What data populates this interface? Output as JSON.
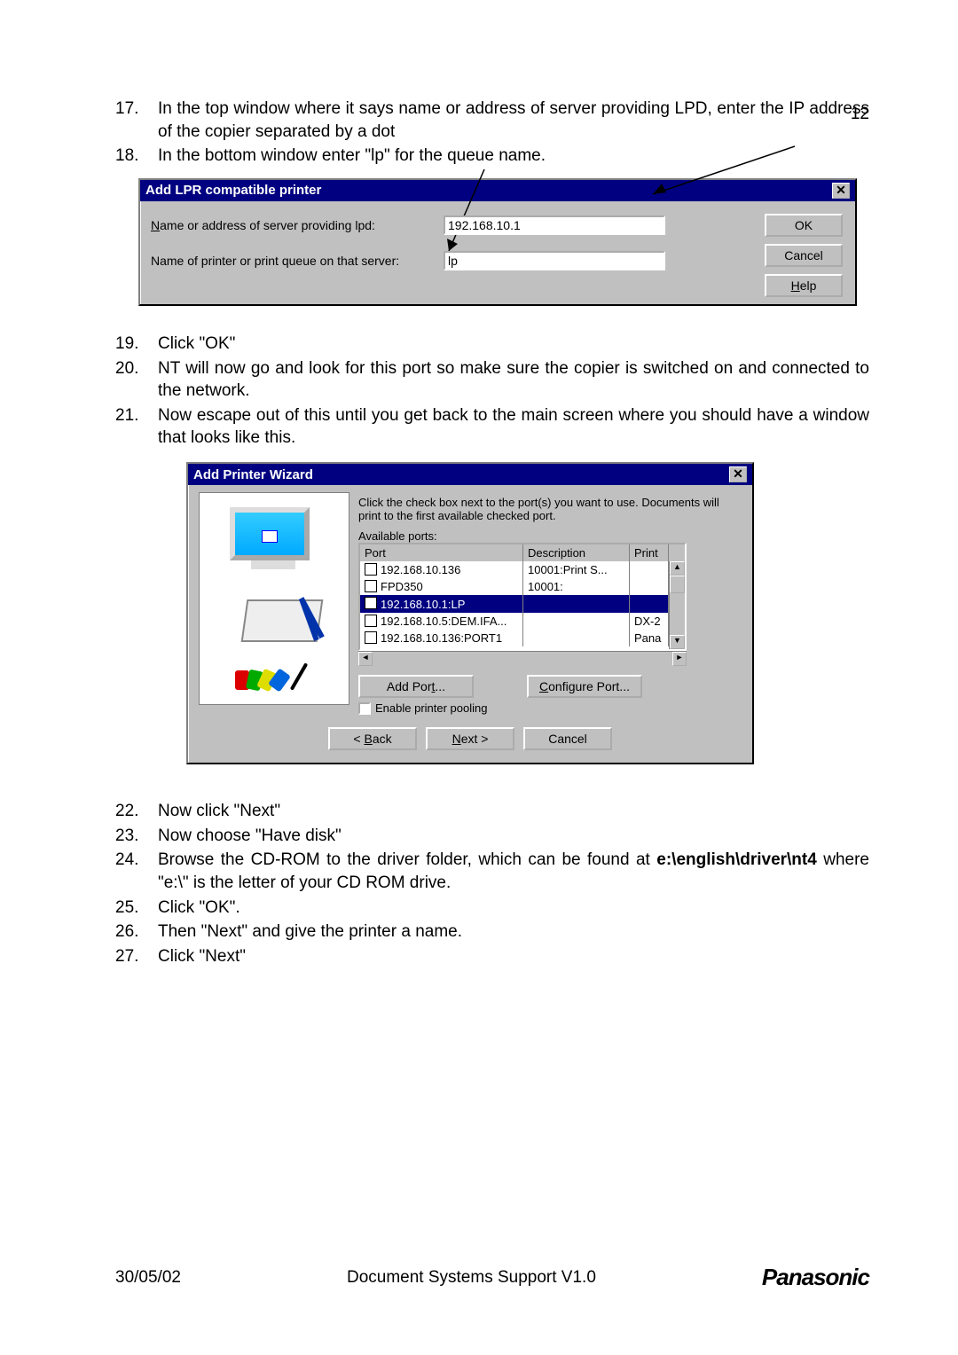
{
  "page_number": "12",
  "steps_a": [
    {
      "n": "17.",
      "t": "In the top window where it says name or address of server providing LPD, enter the IP address of the copier separated by a dot"
    },
    {
      "n": "18.",
      "t": "In the bottom window enter \"lp\" for the queue name."
    }
  ],
  "dlg1": {
    "title": "Add LPR compatible printer",
    "label_server_pre": "N",
    "label_server_post": "ame or address of server providing lpd:",
    "label_queue": "Name of printer or print queue on that server:",
    "val_server": "192.168.10.1",
    "val_queue": "lp",
    "btn_ok": "OK",
    "btn_cancel": "Cancel",
    "btn_help_pre": "H",
    "btn_help_post": "elp"
  },
  "steps_b": [
    {
      "n": "19.",
      "t": "Click \"OK\""
    },
    {
      "n": "20.",
      "t": "NT will now go and look for this port so make sure the copier is switched on and connected to the network."
    },
    {
      "n": "21.",
      "t": "Now escape out of this until you get back to the main screen where you should have a window that looks like this."
    }
  ],
  "dlg2": {
    "title": "Add Printer Wizard",
    "instr": "Click the check box next to the port(s) you want to use. Documents will print to the first available checked port.",
    "avail_pre": "A",
    "avail_post": "vailable ports:",
    "hdr_port": "Port",
    "hdr_desc": "Description",
    "hdr_pr": "Print",
    "rows": [
      {
        "port": "192.168.10.136",
        "desc": "10001:Print S...",
        "pr": "",
        "checked": false,
        "sel": false
      },
      {
        "port": "FPD350",
        "desc": "10001:",
        "pr": "",
        "checked": false,
        "sel": false
      },
      {
        "port": "192.168.10.1:LP",
        "desc": "",
        "pr": "",
        "checked": true,
        "sel": true
      },
      {
        "port": "192.168.10.5:DEM.IFA...",
        "desc": "",
        "pr": "DX-2",
        "checked": false,
        "sel": false
      },
      {
        "port": "192.168.10.136:PORT1",
        "desc": "",
        "pr": "Pana",
        "checked": false,
        "sel": false
      }
    ],
    "add_port_pre": "Add Por",
    "add_port_u": "t",
    "add_port_post": "...",
    "conf_port_pre": "C",
    "conf_port_post": "onfigure Port...",
    "pool_pre": "E",
    "pool_post": "nable printer pooling",
    "back_pre": "< ",
    "back_u": "B",
    "back_post": "ack",
    "next_pre": "N",
    "next_post": "ext >",
    "cancel": "Cancel"
  },
  "steps_c": [
    {
      "n": "22.",
      "t": "Now click \"Next\""
    },
    {
      "n": "23.",
      "t": "Now choose \"Have disk\""
    },
    {
      "n": "24.",
      "t_pre": "Browse the CD-ROM to the driver folder, which can be found at ",
      "t_bold": "e:\\english\\driver\\nt4",
      "t_post": "  where \"e:\\\" is the letter of your CD ROM drive."
    },
    {
      "n": "25.",
      "t": "Click \"OK\"."
    },
    {
      "n": "26.",
      "t": "Then \"Next\" and give the printer a name."
    },
    {
      "n": "27.",
      "t": "Click \"Next\""
    }
  ],
  "footer": {
    "date": "30/05/02",
    "center": "Document Systems Support V1.0",
    "brand": "Panasonic"
  }
}
